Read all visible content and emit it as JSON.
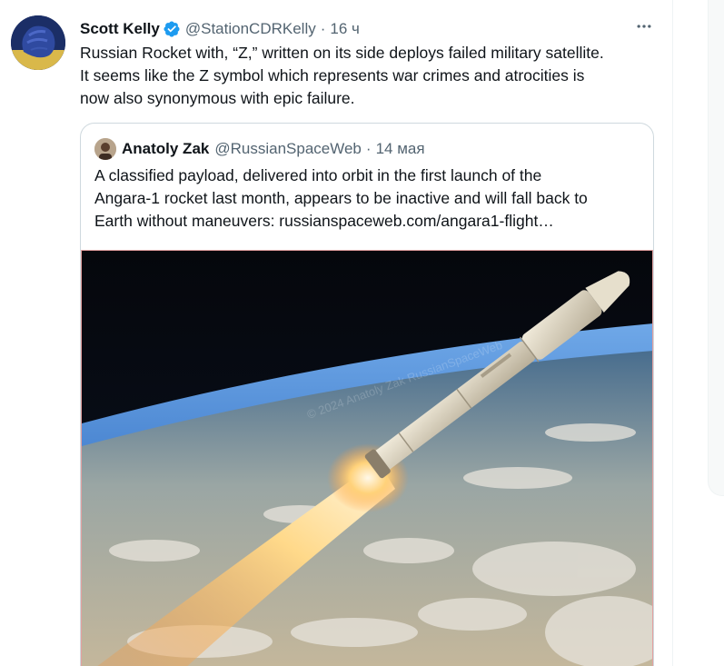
{
  "tweet": {
    "author_name": "Scott Kelly",
    "handle": "@StationCDRKelly",
    "separator": "·",
    "time": "16 ч",
    "text": "Russian Rocket with, “Z,” written on its side deploys failed military satellite.\nIt seems like the Z symbol which represents war crimes and atrocities is\nnow also synonymous with epic failure.",
    "verified_icon": "verified-badge-icon",
    "more_icon": "more-options-icon"
  },
  "quote": {
    "author_name": "Anatoly Zak",
    "handle": "@RussianSpaceWeb",
    "separator": "·",
    "time": "14 мая",
    "text": "A classified payload, delivered into orbit in the first launch of the\nAngara-1 rocket last month, appears to be inactive and will fall back to\nEarth without maneuvers: russianspaceweb.com/angara1-flight…",
    "image_watermark": "© 2024 Anatoly Zak RussianSpaceWeb"
  },
  "colors": {
    "verified": "#1d9bf0",
    "secondary_text": "#536471",
    "border": "#cfd9de"
  }
}
